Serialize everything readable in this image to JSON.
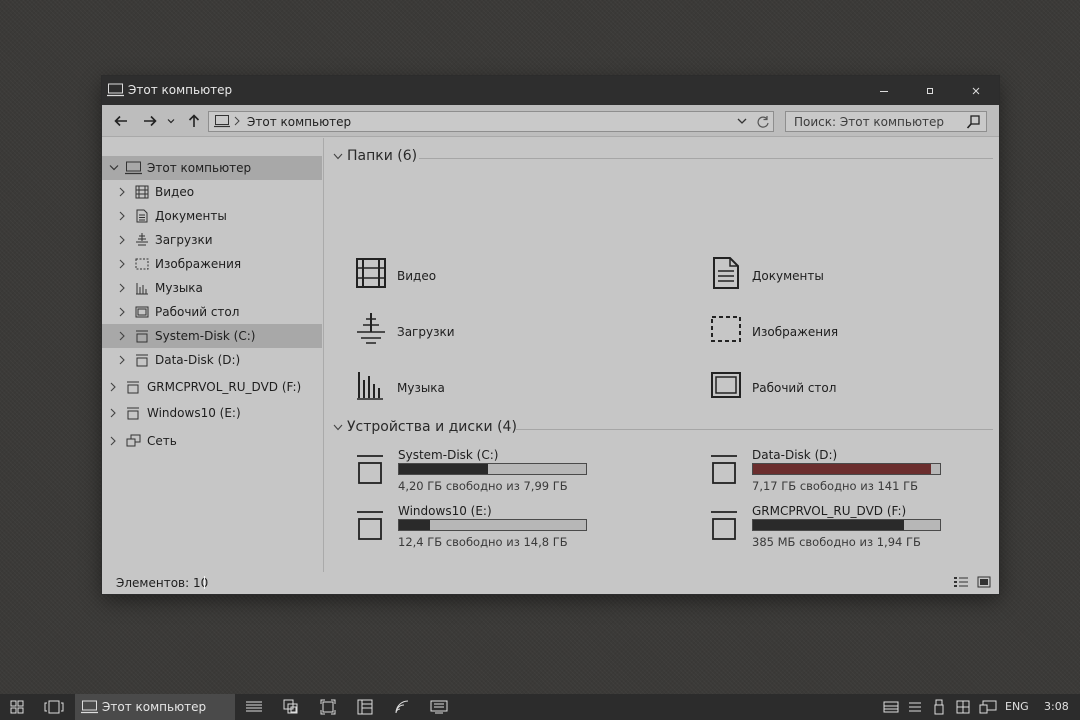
{
  "window": {
    "title": "Этот компьютер",
    "controls": [
      "minimize-icon",
      "maximize-icon",
      "close-icon"
    ]
  },
  "toolbar": {
    "address": "Этот компьютер",
    "search_placeholder": "Поиск: Этот компьютер"
  },
  "sidebar": {
    "items": [
      {
        "label": "Этот компьютер",
        "icon": "computer-icon",
        "selected": true
      },
      {
        "label": "Видео",
        "icon": "film-icon"
      },
      {
        "label": "Документы",
        "icon": "document-icon"
      },
      {
        "label": "Загрузки",
        "icon": "download-icon"
      },
      {
        "label": "Изображения",
        "icon": "image-icon"
      },
      {
        "label": "Музыка",
        "icon": "music-icon"
      },
      {
        "label": "Рабочий стол",
        "icon": "desktop-icon"
      },
      {
        "label": "System-Disk (C:)",
        "icon": "drive-icon",
        "selected": true
      },
      {
        "label": "Data-Disk (D:)",
        "icon": "drive-icon"
      },
      {
        "label": "GRMCPRVOL_RU_DVD (F:)",
        "icon": "dvd-drive-icon"
      },
      {
        "label": "Windows10 (E:)",
        "icon": "usb-drive-icon"
      },
      {
        "label": "Сеть",
        "icon": "network-icon"
      }
    ]
  },
  "folders": {
    "header": "Папки (6)",
    "items": [
      {
        "label": "Видео",
        "icon": "film-icon"
      },
      {
        "label": "Документы",
        "icon": "document-icon"
      },
      {
        "label": "Загрузки",
        "icon": "download-icon"
      },
      {
        "label": "Изображения",
        "icon": "image-icon"
      },
      {
        "label": "Музыка",
        "icon": "music-icon"
      },
      {
        "label": "Рабочий стол",
        "icon": "desktop-icon"
      }
    ]
  },
  "drives": {
    "header": "Устройства и диски (4)",
    "items": [
      {
        "name": "System-Disk (C:)",
        "info": "4,20 ГБ свободно из 7,99 ГБ",
        "used_fraction": 0.475,
        "bar_color": "#2a2a2a"
      },
      {
        "name": "Data-Disk (D:)",
        "info": "7,17 ГБ свободно из 141 ГБ",
        "used_fraction": 0.95,
        "bar_color": "#6b2e2e"
      },
      {
        "name": "Windows10 (E:)",
        "info": "12,4 ГБ свободно из 14,8 ГБ",
        "used_fraction": 0.165,
        "bar_color": "#2a2a2a"
      },
      {
        "name": "GRMCPRVOL_RU_DVD (F:)",
        "info": "385 МБ свободно из 1,94 ГБ",
        "used_fraction": 0.81,
        "bar_color": "#2a2a2a"
      }
    ]
  },
  "status": {
    "count": "Элементов: 10"
  },
  "taskbar": {
    "app_label": "Этот компьютер",
    "language": "ENG",
    "clock": "3:08"
  }
}
